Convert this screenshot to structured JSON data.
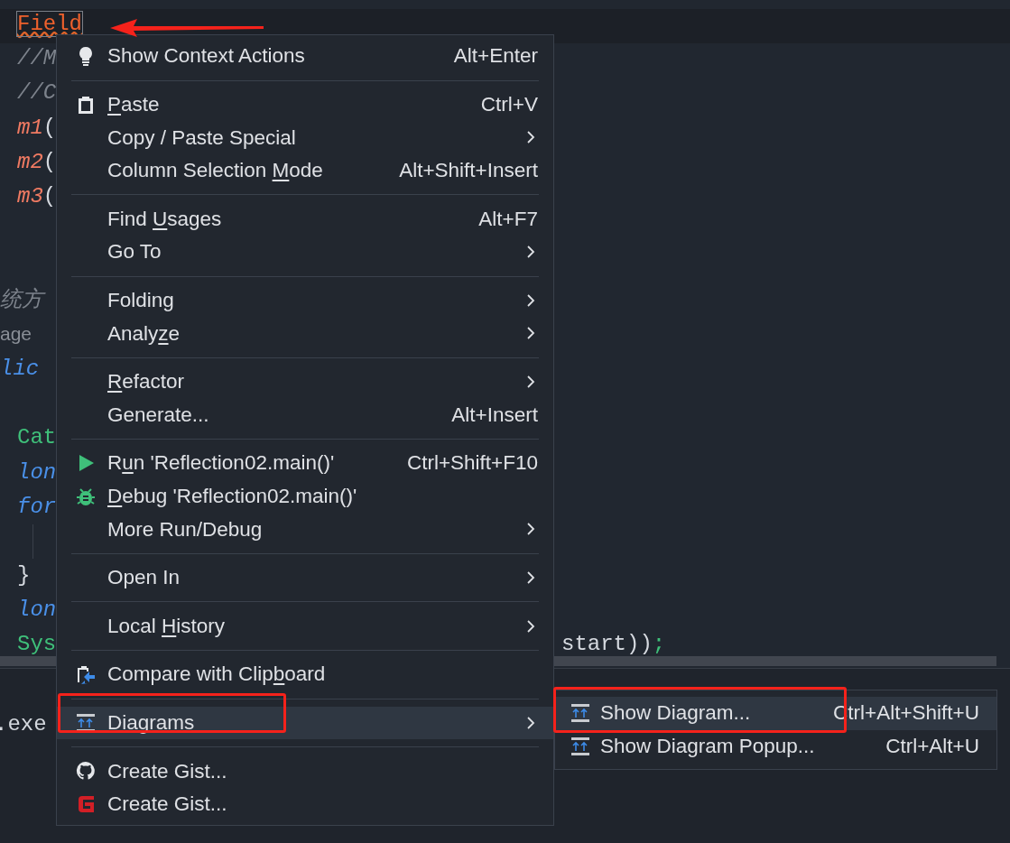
{
  "editor": {
    "lines": [
      {
        "segments": [
          {
            "text": "Field",
            "kind": "error"
          }
        ]
      },
      {
        "segments": [
          {
            "text": "//M",
            "kind": "comment"
          }
        ]
      },
      {
        "segments": [
          {
            "text": "//C",
            "kind": "comment"
          }
        ]
      },
      {
        "segments": [
          {
            "text": "m1",
            "kind": "method"
          },
          {
            "text": "(",
            "kind": "plain"
          }
        ]
      },
      {
        "segments": [
          {
            "text": "m2",
            "kind": "method"
          },
          {
            "text": "(",
            "kind": "plain"
          }
        ]
      },
      {
        "segments": [
          {
            "text": "m3",
            "kind": "method"
          },
          {
            "text": "(",
            "kind": "plain"
          }
        ]
      },
      {
        "kind": "blank"
      },
      {
        "kind": "blank"
      },
      {
        "clipped": true,
        "segments": [
          {
            "text": "统方",
            "kind": "comment"
          }
        ]
      },
      {
        "clipped": true,
        "segments": [
          {
            "text": "age",
            "kind": "hint"
          }
        ]
      },
      {
        "clipped": true,
        "segments": [
          {
            "text": "lic",
            "kind": "keyword"
          }
        ]
      },
      {
        "kind": "blank"
      },
      {
        "segments": [
          {
            "text": "Cat",
            "kind": "type"
          }
        ]
      },
      {
        "segments": [
          {
            "text": "lon",
            "kind": "keyword"
          }
        ]
      },
      {
        "segments": [
          {
            "text": "for",
            "kind": "keyword"
          }
        ]
      },
      {
        "kind": "guide"
      },
      {
        "segments": [
          {
            "text": "}",
            "kind": "plain"
          }
        ]
      },
      {
        "segments": [
          {
            "text": "lon",
            "kind": "keyword"
          }
        ]
      },
      {
        "segments": [
          {
            "text": "Sys",
            "kind": "type"
          }
        ],
        "tail": [
          {
            "text": "start))",
            "kind": "plain"
          },
          {
            "text": ";",
            "kind": "type"
          }
        ]
      }
    ]
  },
  "console": {
    "lines": [
      ".exe"
    ]
  },
  "menu": {
    "groups": [
      {
        "items": [
          {
            "kind": "bulb",
            "label": {
              "pre": "Show Context Actions"
            },
            "shortcut": "Alt+Enter",
            "submenu": false,
            "selected": false
          }
        ]
      },
      {
        "items": [
          {
            "kind": "clipboard",
            "label": {
              "key": "P",
              "post": "aste"
            },
            "shortcut": "Ctrl+V",
            "submenu": false,
            "selected": false
          },
          {
            "label": {
              "pre": "Copy / Paste Special"
            },
            "submenu": true,
            "selected": false
          },
          {
            "label": {
              "pre": "Column Selection ",
              "key": "M",
              "post": "ode"
            },
            "shortcut": "Alt+Shift+Insert",
            "submenu": false,
            "selected": false
          }
        ]
      },
      {
        "items": [
          {
            "label": {
              "pre": "Find ",
              "key": "U",
              "post": "sages"
            },
            "shortcut": "Alt+F7",
            "submenu": false,
            "selected": false
          },
          {
            "label": {
              "pre": "Go To"
            },
            "submenu": true,
            "selected": false
          }
        ]
      },
      {
        "items": [
          {
            "label": {
              "pre": "Folding"
            },
            "submenu": true,
            "selected": false
          },
          {
            "label": {
              "pre": "Analy",
              "key": "z",
              "post": "e"
            },
            "submenu": true,
            "selected": false
          }
        ]
      },
      {
        "items": [
          {
            "label": {
              "key": "R",
              "post": "efactor"
            },
            "submenu": true,
            "selected": false
          },
          {
            "label": {
              "pre": "Generate..."
            },
            "shortcut": "Alt+Insert",
            "submenu": false,
            "selected": false
          }
        ]
      },
      {
        "items": [
          {
            "kind": "play",
            "label": {
              "pre": "R",
              "key": "u",
              "post": "n 'Reflection02.main()'"
            },
            "shortcut": "Ctrl+Shift+F10",
            "submenu": false,
            "selected": false
          },
          {
            "kind": "bug",
            "label": {
              "key": "D",
              "post": "ebug 'Reflection02.main()'"
            },
            "submenu": false,
            "selected": false
          },
          {
            "label": {
              "pre": "More Run/Debug"
            },
            "submenu": true,
            "selected": false
          }
        ]
      },
      {
        "items": [
          {
            "label": {
              "pre": "Open In"
            },
            "submenu": true,
            "selected": false
          }
        ]
      },
      {
        "items": [
          {
            "label": {
              "pre": "Local ",
              "key": "H",
              "post": "istory"
            },
            "submenu": true,
            "selected": false
          }
        ]
      },
      {
        "items": [
          {
            "kind": "compare",
            "label": {
              "pre": "Compare with Clip",
              "key": "b",
              "post": "oard"
            },
            "submenu": false,
            "selected": false
          }
        ]
      },
      {
        "items": [
          {
            "kind": "diagram",
            "label": {
              "pre": "Diagrams"
            },
            "submenu": true,
            "selected": true
          }
        ]
      },
      {
        "items": [
          {
            "kind": "github",
            "label": {
              "pre": "Create Gist..."
            },
            "submenu": false,
            "selected": false
          },
          {
            "kind": "gitee",
            "label": {
              "pre": "Create Gist..."
            },
            "submenu": false,
            "selected": false
          }
        ]
      }
    ]
  },
  "submenu": {
    "items": [
      {
        "kind": "diagram",
        "label": {
          "pre": "Show Diagram..."
        },
        "shortcut": "Ctrl+Alt+Shift+U",
        "selected": true
      },
      {
        "kind": "diagram",
        "label": {
          "pre": "Show Diagram Popup..."
        },
        "shortcut": "Ctrl+Alt+U",
        "selected": false
      }
    ]
  }
}
